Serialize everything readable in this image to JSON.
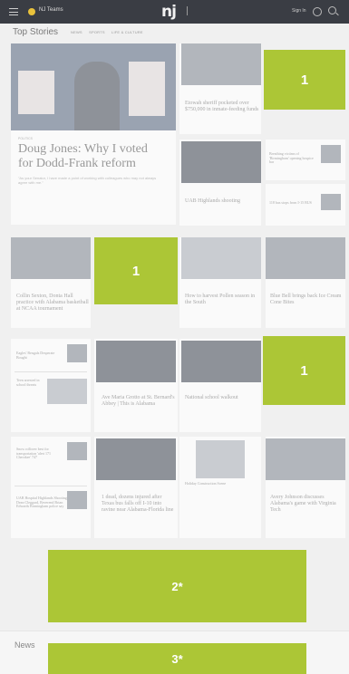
{
  "header": {
    "location": "NJ Teams",
    "logo": "nj",
    "signin": "Sign In"
  },
  "top_stories": {
    "title": "Top Stories",
    "tabs": [
      "NEWS",
      "SPORTS",
      "LIFE & CULTURE"
    ]
  },
  "lead": {
    "headline": "Doug Jones: Why I voted for Dodd-Frank reform",
    "description": "\"As your Senator, I have made a point of working with colleagues who may not always agree with me.\""
  },
  "stories": {
    "s1": "Etowah sheriff pocketed over $750,000 in inmate-feeding funds",
    "s2": "UAB Highlands shooting",
    "s3": "Collin Sexton, Donta Hall practice with Alabama basketball at NCAA tournament",
    "s4": "How to harvest Pollen season in the South",
    "s5": "Blue Bell brings back Ice Cream Cone Bites",
    "s6": "Ave Maria Grotto at St. Bernard's Abbey | This is Alabama",
    "s7": "National school walkout",
    "s8": "1 dead, dozens injured after Texas bus falls off I-10 into ravine near Alabama-Florida line",
    "s9": "Avery Johnson discusses Alabama's game with Virginia Tech",
    "s10": "Holiday Construction Scene",
    "side1": "Breathing victims of 'Birmingham' opening hospice bar",
    "side2": "118 bus stops from I-15 BUS",
    "small1": "Eagles' Bengals Desperate Bought",
    "small2": "Teen arrested in school threats",
    "small3": "Snow rollover best for transportation 'alert 171 Cherokee' 747",
    "small4": "UAB Hospital Highlands Shooting | Dean Cleggard, Reverend Brian Edwards Birmingham police say"
  },
  "ads": {
    "a1": "1",
    "a2": "1",
    "a3": "1",
    "a4": "2*",
    "a5": "3*"
  },
  "news": {
    "title": "News"
  }
}
